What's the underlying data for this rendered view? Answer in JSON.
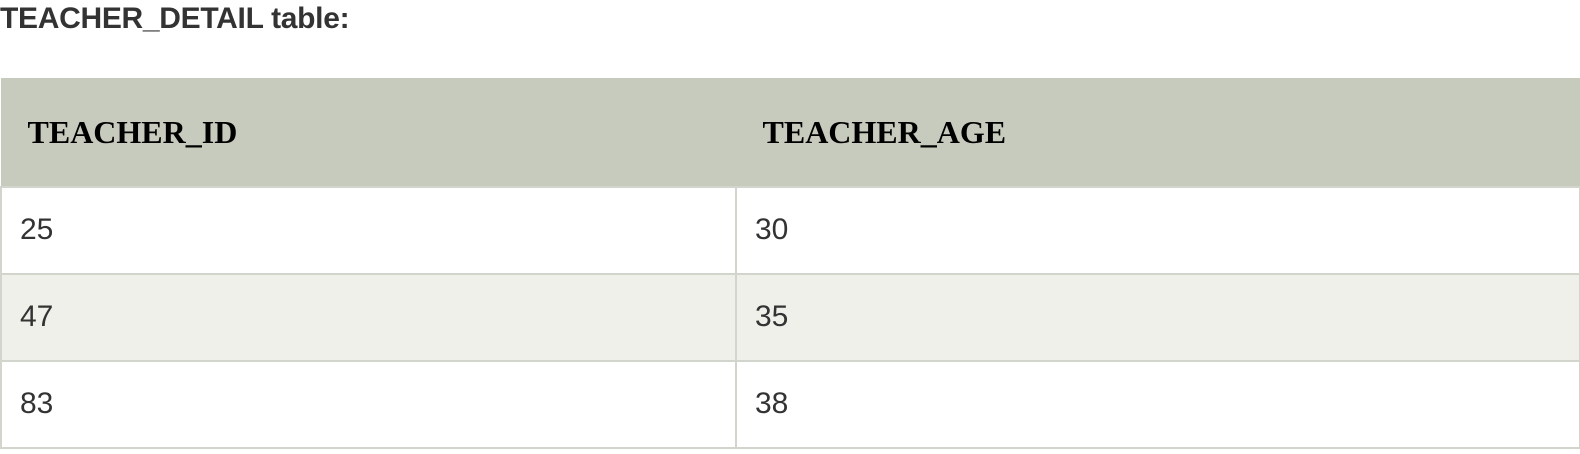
{
  "heading": "TEACHER_DETAIL table:",
  "table": {
    "columns": [
      "TEACHER_ID",
      "TEACHER_AGE"
    ],
    "rows": [
      [
        "25",
        "30"
      ],
      [
        "47",
        "35"
      ],
      [
        "83",
        "38"
      ]
    ]
  },
  "colors": {
    "header_bg": "#c7cbbd",
    "alt_row_bg": "#eef0e9",
    "border": "#d2d5cb",
    "text": "#333333"
  }
}
